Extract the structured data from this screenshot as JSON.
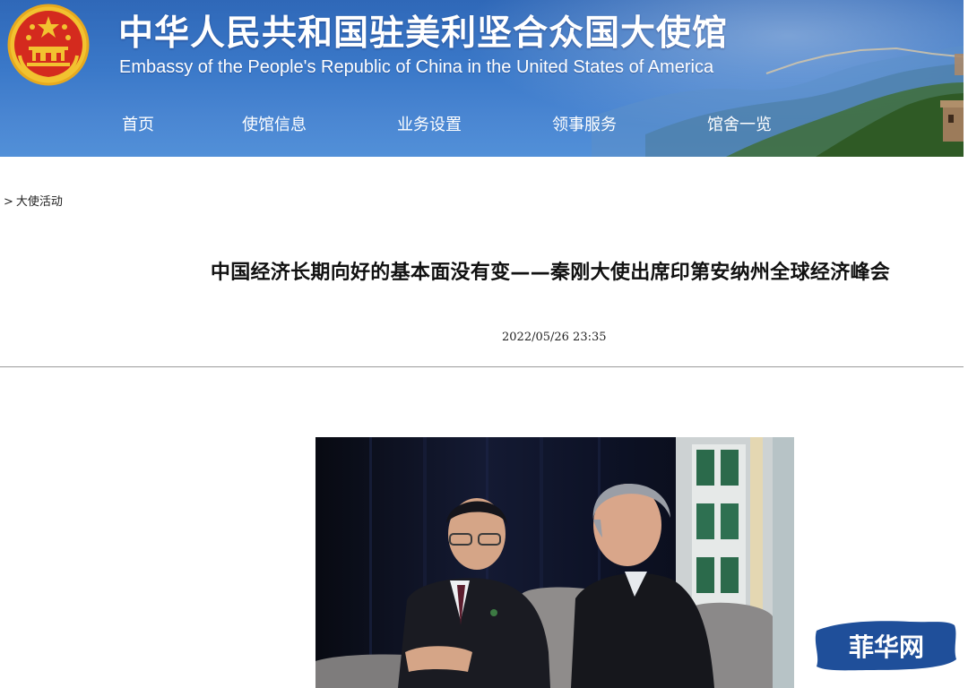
{
  "header": {
    "title_cn": "中华人民共和国驻美利坚合众国大使馆",
    "title_en": "Embassy of the People's Republic of China in the United States of America",
    "emblem_icon": "national-emblem-icon",
    "colors": {
      "banner_blue": "#3b79c9",
      "emblem_red": "#d42a1e",
      "emblem_gold": "#f2c230"
    }
  },
  "nav": {
    "items": [
      {
        "label": "首页"
      },
      {
        "label": "使馆信息"
      },
      {
        "label": "业务设置"
      },
      {
        "label": "领事服务"
      },
      {
        "label": "馆舍一览"
      }
    ]
  },
  "breadcrumb": {
    "arrow": ">",
    "label": "大使活动"
  },
  "article": {
    "title": "中国经济长期向好的基本面没有变——秦刚大使出席印第安纳州全球经济峰会",
    "date": "2022/05/26 23:35"
  },
  "watermark": {
    "text": "菲华网",
    "color": "#1f4f9a"
  }
}
